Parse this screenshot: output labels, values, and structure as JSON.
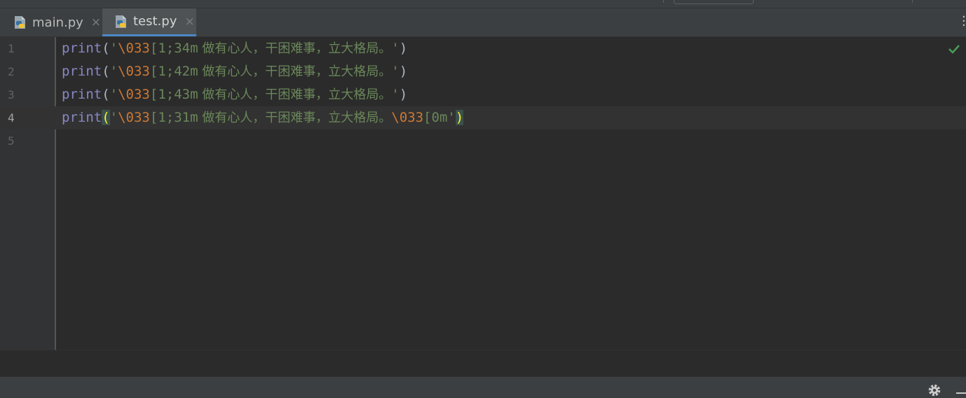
{
  "tabs": [
    {
      "label": "main.py",
      "active": false,
      "icon": "python-file-icon",
      "close": "×"
    },
    {
      "label": "test.py",
      "active": true,
      "icon": "python-file-icon",
      "close": "×"
    }
  ],
  "editor": {
    "lines": [
      {
        "number": "1",
        "func": "print",
        "open": "(",
        "quote_open": "'",
        "esc": "\\033",
        "code": "[1;34m",
        "text": " 做有心人，干困难事，立大格局。",
        "esc2": "",
        "code2": "",
        "quote_close": "'",
        "close": ")",
        "current": false
      },
      {
        "number": "2",
        "func": "print",
        "open": "(",
        "quote_open": "'",
        "esc": "\\033",
        "code": "[1;42m",
        "text": " 做有心人，干困难事，立大格局。",
        "esc2": "",
        "code2": "",
        "quote_close": "'",
        "close": ")",
        "current": false
      },
      {
        "number": "3",
        "func": "print",
        "open": "(",
        "quote_open": "'",
        "esc": "\\033",
        "code": "[1;43m",
        "text": " 做有心人，干困难事，立大格局。",
        "esc2": "",
        "code2": "",
        "quote_close": "'",
        "close": ")",
        "current": false
      },
      {
        "number": "4",
        "func": "print",
        "open": "(",
        "quote_open": "'",
        "esc": "\\033",
        "code": "[1;31m",
        "text": " 做有心人，干困难事，立大格局。",
        "esc2": "\\033",
        "code2": "[0m",
        "quote_close": "'",
        "close": ")",
        "current": true
      },
      {
        "number": "5",
        "func": "",
        "open": "",
        "quote_open": "",
        "esc": "",
        "code": "",
        "text": "",
        "esc2": "",
        "code2": "",
        "quote_close": "",
        "close": "",
        "current": false
      }
    ],
    "inspection_icon": "checkmark-icon"
  },
  "statusbar": {
    "icons": [
      "gear-icon",
      "minimize-icon"
    ]
  },
  "colors": {
    "background": "#2b2b2b",
    "keyword": "#8888c6",
    "string": "#6a8759",
    "escape": "#cc7832",
    "bracket_highlight": "#ffef28",
    "tab_underline": "#4a88c7",
    "check": "#499c54"
  }
}
